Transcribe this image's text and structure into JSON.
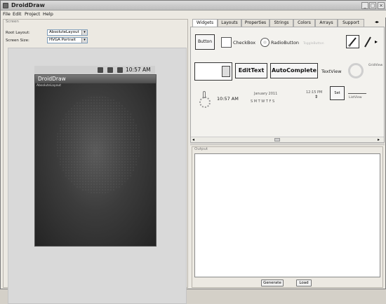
{
  "window": {
    "title": "DroidDraw"
  },
  "window_controls": {
    "minimize": "_",
    "maximize": "□",
    "close": "×"
  },
  "menu": [
    "File",
    "Edit",
    "Project",
    "Help"
  ],
  "screen_panel": {
    "group_title": "Screen",
    "root_layout_label": "Root Layout:",
    "root_layout_value": "AbsoluteLayout",
    "screen_size_label": "Screen Size:",
    "screen_size_value": "HVGA Portrait"
  },
  "device": {
    "time": "10:57 AM",
    "app_title": "DroidDraw",
    "layout_label": "AbsoluteLayout"
  },
  "tabs": [
    "Widgets",
    "Layouts",
    "Properties",
    "Strings",
    "Colors",
    "Arrays",
    "Support"
  ],
  "active_tab": "Widgets",
  "widgets": {
    "button": "Button",
    "checkbox": "CheckBox",
    "radiobutton": "RadioButton",
    "edittext": "EditText",
    "autocomplete": "AutoComplete",
    "textview": "TextView",
    "digital_clock": "10:57 AM",
    "date_month": "January 2011",
    "date_days": "S  M  T  W  T  F  S",
    "time_picker": "12:15 PM",
    "set_button": "Set",
    "listview": "ListView",
    "gridview": "GridView",
    "faint_label": "ToggleButton"
  },
  "output_panel": {
    "group_title": "Output",
    "generate_button": "Generate",
    "load_button": "Load"
  }
}
